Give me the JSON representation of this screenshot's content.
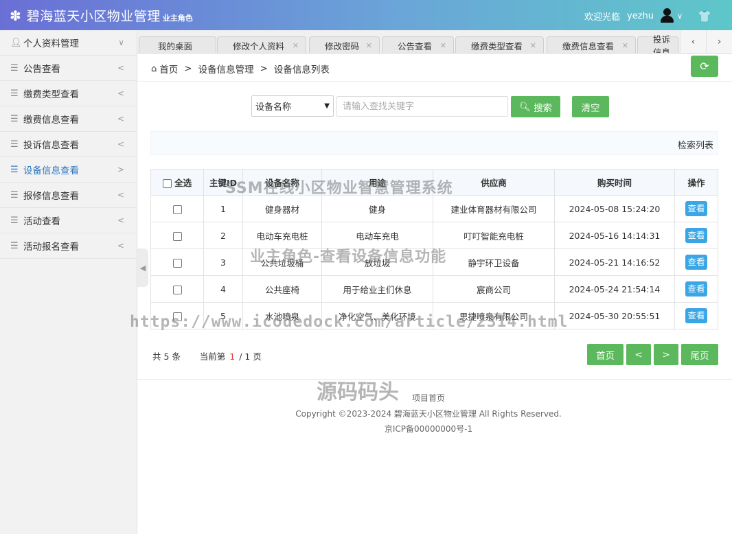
{
  "header": {
    "title": "碧海蓝天小区物业管理",
    "role": "业主角色",
    "welcome": "欢迎光临",
    "username": "yezhu"
  },
  "sidebar": {
    "items": [
      {
        "label": "个人资料管理",
        "icon": "user-icon",
        "arrow": "∨"
      },
      {
        "label": "公告查看",
        "icon": "list-icon",
        "arrow": "<"
      },
      {
        "label": "缴费类型查看",
        "icon": "list-icon",
        "arrow": "<"
      },
      {
        "label": "缴费信息查看",
        "icon": "list-icon",
        "arrow": "<"
      },
      {
        "label": "投诉信息查看",
        "icon": "list-icon",
        "arrow": "<"
      },
      {
        "label": "设备信息查看",
        "icon": "list-icon",
        "arrow": ">",
        "active": true
      },
      {
        "label": "报修信息查看",
        "icon": "list-icon",
        "arrow": "<"
      },
      {
        "label": "活动查看",
        "icon": "list-icon",
        "arrow": "<"
      },
      {
        "label": "活动报名查看",
        "icon": "list-icon",
        "arrow": "<"
      }
    ]
  },
  "tabs": [
    "我的桌面",
    "修改个人资料",
    "修改密码",
    "公告查看",
    "缴费类型查看",
    "缴费信息查看",
    "投诉信息"
  ],
  "breadcrumb": {
    "home": "首页",
    "level1": "设备信息管理",
    "level2": "设备信息列表"
  },
  "search": {
    "field_selected": "设备名称",
    "placeholder": "请输入查找关键字",
    "search_label": "搜索",
    "clear_label": "清空"
  },
  "result_title": "检索列表",
  "table": {
    "headers": {
      "select_all": "全选",
      "id": "主键ID",
      "name": "设备名称",
      "usage": "用途",
      "supplier": "供应商",
      "time": "购买时间",
      "action": "操作"
    },
    "rows": [
      {
        "id": "1",
        "name": "健身器材",
        "usage": "健身",
        "supplier": "建业体育器材有限公司",
        "time": "2024-05-08 15:24:20",
        "action": "查看"
      },
      {
        "id": "2",
        "name": "电动车充电桩",
        "usage": "电动车充电",
        "supplier": "叮叮智能充电桩",
        "time": "2024-05-16 14:14:31",
        "action": "查看"
      },
      {
        "id": "3",
        "name": "公共垃圾桶",
        "usage": "放垃圾",
        "supplier": "静宇环卫设备",
        "time": "2024-05-21 14:16:52",
        "action": "查看"
      },
      {
        "id": "4",
        "name": "公共座椅",
        "usage": "用于给业主们休息",
        "supplier": "宸商公司",
        "time": "2024-05-24 21:54:14",
        "action": "查看"
      },
      {
        "id": "5",
        "name": "水池喷泉",
        "usage": "净化空气、美化环境",
        "supplier": "思捷喷泉有限公司",
        "time": "2024-05-30 20:55:51",
        "action": "查看"
      }
    ]
  },
  "pagination": {
    "total_prefix": "共",
    "total": "5",
    "total_suffix": "条",
    "current_prefix": "当前第",
    "current": "1",
    "pages": "/ 1 页",
    "first": "首页",
    "prev": "<",
    "next": ">",
    "last": "尾页"
  },
  "footer": {
    "link": "项目首页",
    "copyright": "Copyright ©2023-2024 碧海蓝天小区物业管理 All Rights Reserved.",
    "icp": "京ICP备00000000号-1"
  },
  "watermarks": {
    "line1": "SSM在线小区物业智慧管理系统",
    "line2": "业主角色-查看设备信息功能",
    "line3": "https://www.icodedock.com/article/2314.html",
    "line4": "源码码头"
  }
}
